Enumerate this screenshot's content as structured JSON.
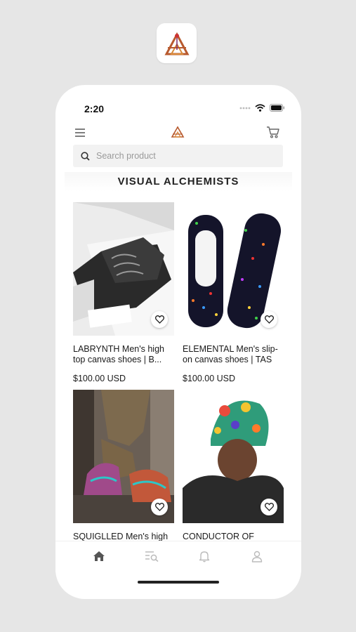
{
  "status_bar": {
    "time": "2:20"
  },
  "header": {
    "menu_icon": "hamburger-menu-icon",
    "logo": "visual-alchemists-logo",
    "cart_icon": "shopping-cart-icon"
  },
  "search": {
    "placeholder": "Search product",
    "value": ""
  },
  "page": {
    "title": "VISUAL ALCHEMISTS"
  },
  "products": [
    {
      "name": "LABRYNTH Men's high top canvas shoes | B...",
      "price": "$100.00 USD"
    },
    {
      "name": "ELEMENTAL Men's slip-on canvas shoes | TAS",
      "price": "$100.00 USD"
    },
    {
      "name": "SQUIGLLED Men's high",
      "price": ""
    },
    {
      "name": "CONDUCTOR OF",
      "price": ""
    }
  ],
  "bottom_nav": [
    {
      "icon": "home-icon",
      "active": true
    },
    {
      "icon": "search-list-icon",
      "active": false
    },
    {
      "icon": "bell-icon",
      "active": false
    },
    {
      "icon": "user-icon",
      "active": false
    }
  ],
  "colors": {
    "accent": "#b85a2e",
    "background": "#e6e6e6",
    "nav_active": "#555555",
    "nav_inactive": "#bbbbbb"
  }
}
